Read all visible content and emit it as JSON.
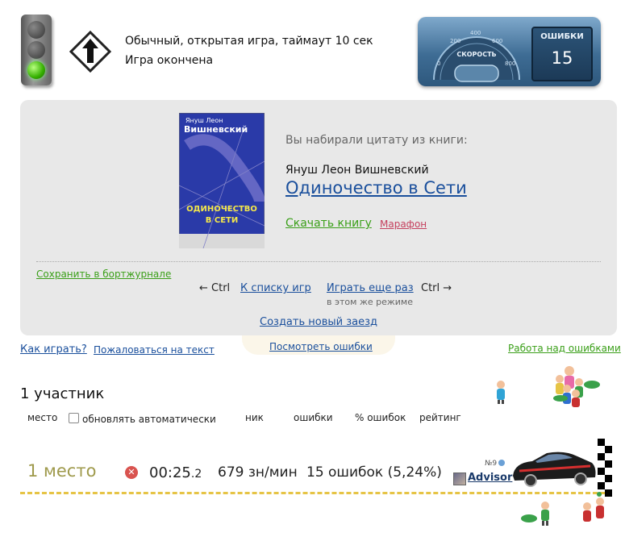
{
  "game": {
    "mode": "Обычный, открытая игра, таймаут 10 сек",
    "status": "Игра окончена"
  },
  "dashboard": {
    "speed_label": "СКОРОСТЬ",
    "ticks": [
      "0",
      "200",
      "400",
      "600",
      "800"
    ],
    "errors_label": "ОШИБКИ",
    "errors_value": "15"
  },
  "result": {
    "from_book_label": "Вы набирали цитату из книги:",
    "author": "Януш Леон Вишневский",
    "book_title": "Одиночество в Сети",
    "download_label": "Скачать книгу",
    "marathon_label": "Марафон",
    "book_cover": {
      "author_line1": "Януш Леон",
      "author_line2": "Вишневский",
      "title_line1": "ОДИНОЧЕСТВО",
      "title_line2": "В СЕТИ"
    },
    "save_log_label": "Сохранить в бортжурнале",
    "ctrl_left": "← Ctrl",
    "to_list_label": "К списку игр",
    "play_again_label": "Играть еще раз",
    "ctrl_right": "Ctrl →",
    "same_mode_label": "в этом же режиме",
    "new_race_label": "Создать новый заезд"
  },
  "links": {
    "how_to_play": "Как играть?",
    "complain": "Пожаловаться на текст",
    "view_errors": "Посмотреть ошибки",
    "work_on_errors": "Работа над ошибками"
  },
  "participants": {
    "count_label": "1 участник",
    "headers": {
      "place": "место",
      "auto_update": "обновлять автоматически",
      "nick": "ник",
      "errors": "ошибки",
      "errors_pct": "% ошибок",
      "rating": "рейтинг"
    },
    "rows": [
      {
        "place": "1 место",
        "time_main": "00:25",
        "time_frac": ".2",
        "speed": "679 зн/мин",
        "errors": "15 ошибок (5,24%)",
        "place_no": "№9",
        "nick": "Advisor"
      }
    ]
  },
  "colors": {
    "link": "#1a4f9c",
    "green_link": "#3a9f18",
    "place": "#9f9a4c",
    "road": "#e6c445"
  }
}
